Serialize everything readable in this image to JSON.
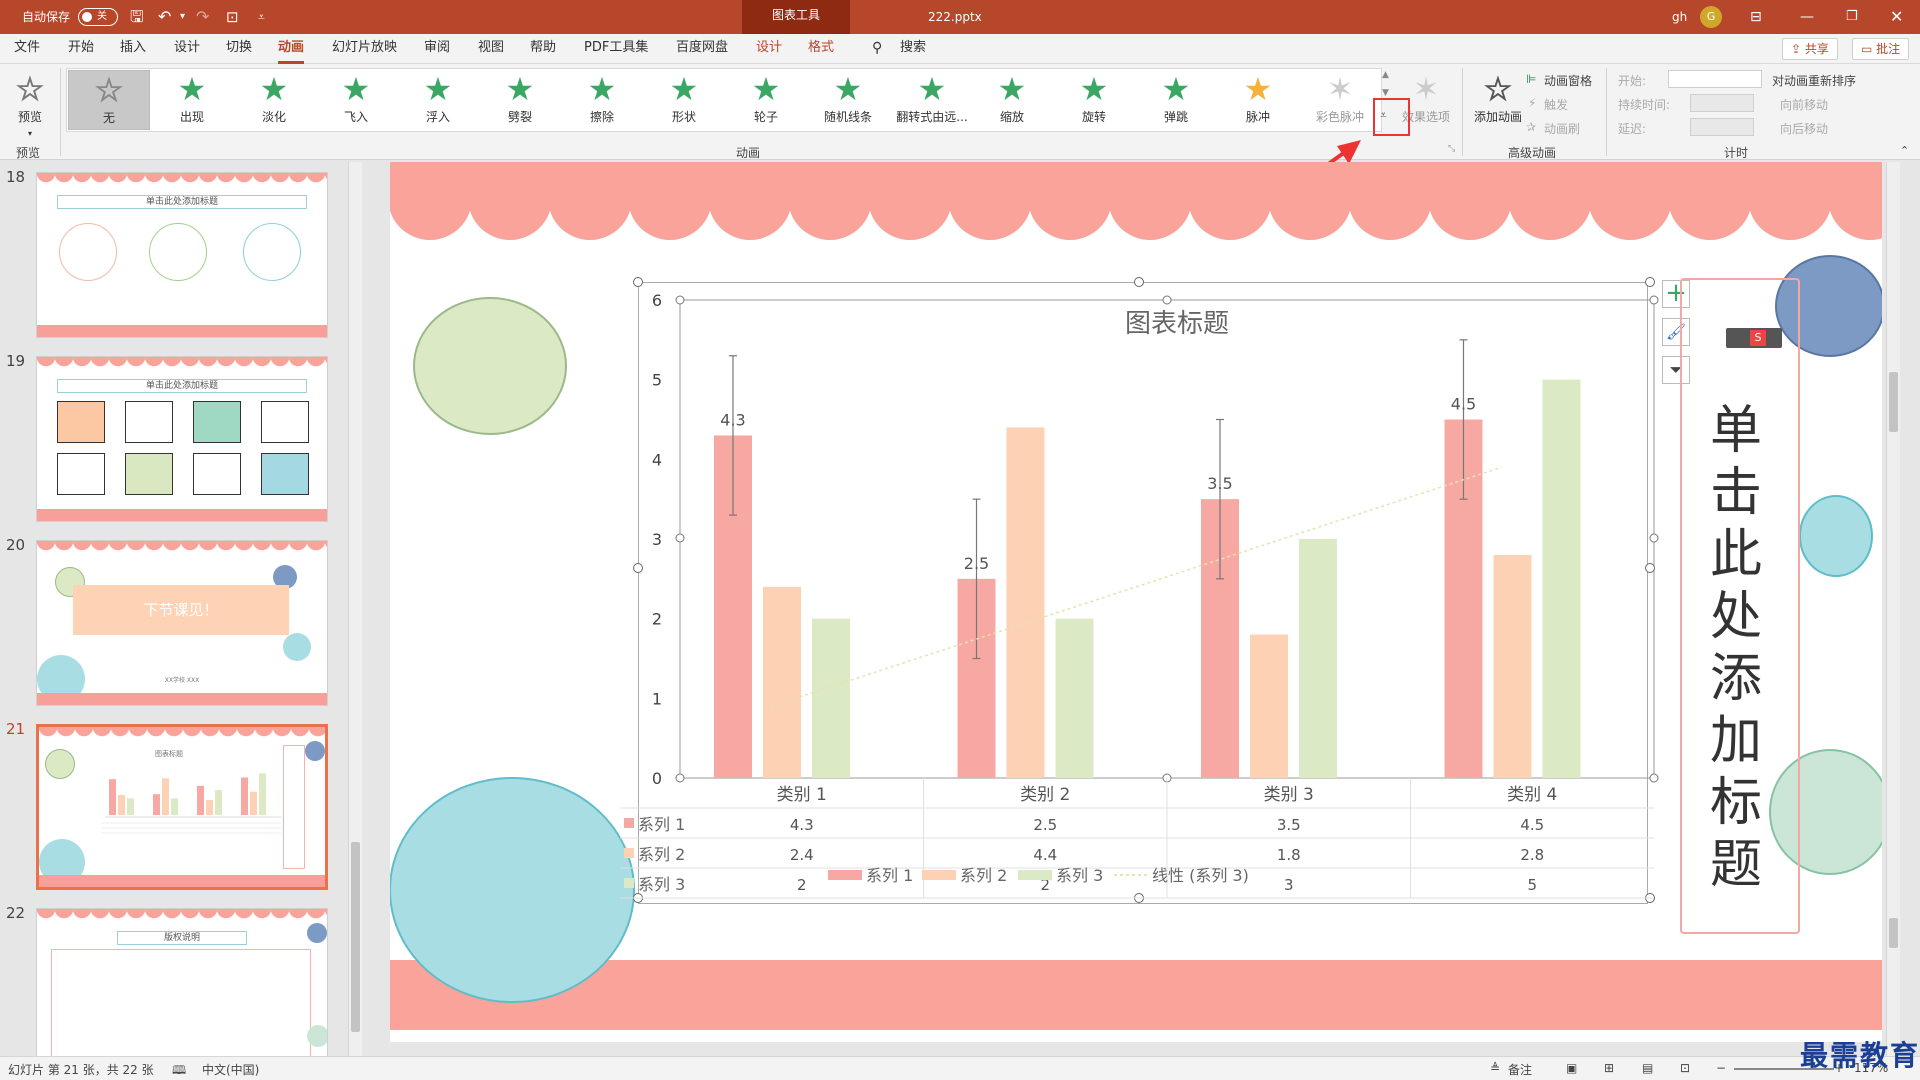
{
  "titlebar": {
    "autosave_label": "自动保存",
    "autosave_state": "关",
    "context_tab": "图表工具",
    "filename": "222.pptx",
    "user": "gh",
    "avatar_letter": "G"
  },
  "tabs": [
    "文件",
    "开始",
    "插入",
    "设计",
    "切换",
    "动画",
    "幻灯片放映",
    "审阅",
    "视图",
    "帮助",
    "PDF工具集",
    "百度网盘",
    "设计",
    "格式"
  ],
  "search_label": "搜索",
  "share_label": "共享",
  "comment_label": "批注",
  "ribbon": {
    "preview_label": "预览",
    "preview_group": "预览",
    "animation_group": "动画",
    "animations": [
      "无",
      "出现",
      "淡化",
      "飞入",
      "浮入",
      "劈裂",
      "擦除",
      "形状",
      "轮子",
      "随机线条",
      "翻转式由远...",
      "缩放",
      "旋转",
      "弹跳",
      "脉冲",
      "彩色脉冲"
    ],
    "effect_options": "效果选项",
    "add_animation": "添加动画",
    "anim_pane": "动画窗格",
    "trigger": "触发",
    "anim_painter": "动画刷",
    "advanced_group": "高级动画",
    "start_label": "开始:",
    "duration_label": "持续时间:",
    "delay_label": "延迟:",
    "timing_group": "计时",
    "reorder_label": "对动画重新排序",
    "move_earlier": "向前移动",
    "move_later": "向后移动"
  },
  "thumbnails": {
    "numbers": [
      "18",
      "19",
      "20",
      "21",
      "22"
    ],
    "s18_title": "单击此处添加标题",
    "s19_title": "单击此处添加标题",
    "s20_text": "下节课见！",
    "s20_sub": "XX学校  XXX",
    "s21_title": "图表标题",
    "s22_title": "版权说明"
  },
  "slide": {
    "vertical_title": "单击此处添加标题"
  },
  "chart_data": {
    "type": "bar",
    "title": "图表标题",
    "categories": [
      "类别 1",
      "类别 2",
      "类别 3",
      "类别 4"
    ],
    "series": [
      {
        "name": "系列 1",
        "values": [
          4.3,
          2.5,
          3.5,
          4.5
        ],
        "color": "#f8a8a2"
      },
      {
        "name": "系列 2",
        "values": [
          2.4,
          4.4,
          1.8,
          2.8
        ],
        "color": "#fdd1b3"
      },
      {
        "name": "系列 3",
        "values": [
          2,
          2,
          3,
          5
        ],
        "color": "#dbe9c4"
      }
    ],
    "ylim": [
      0,
      6
    ],
    "yticks": [
      "0",
      "1",
      "2",
      "3",
      "4",
      "5",
      "6"
    ],
    "data_labels": [
      "4.3",
      "2.5",
      "3.5",
      "4.5"
    ],
    "legend": [
      "系列 1",
      "系列 2",
      "系列 3",
      "线性 (系列 3)"
    ],
    "trendline": "线性 (系列 3)",
    "table": [
      [
        "4.3",
        "2.5",
        "3.5",
        "4.5"
      ],
      [
        "2.4",
        "4.4",
        "1.8",
        "2.8"
      ],
      [
        "2",
        "2",
        "3",
        "5"
      ]
    ],
    "error_bars": true,
    "grid": false
  },
  "status": {
    "slide_info": "幻灯片 第 21 张，共 22 张",
    "language": "中文(中国)",
    "notes": "备注",
    "zoom": "117%"
  },
  "watermark": "最需教育",
  "colors": {
    "accent": "#b7472a",
    "scallop": "#f9a39b",
    "band": "#f7a09a"
  }
}
